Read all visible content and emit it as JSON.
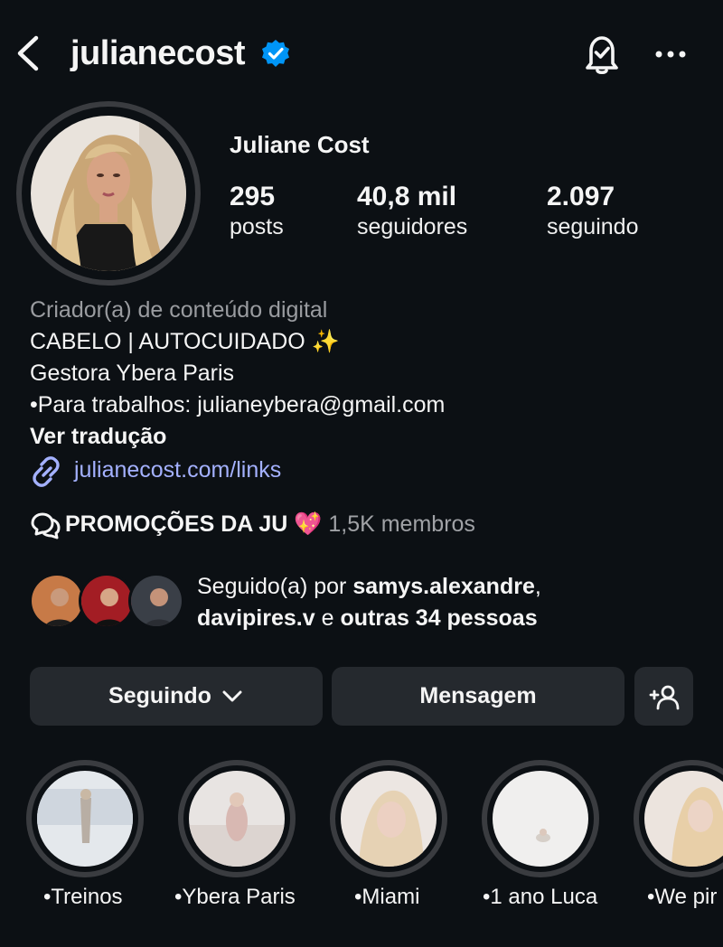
{
  "header": {
    "username": "julianecost",
    "icons": {
      "back": "chevron-left-icon",
      "verified": "verified-badge-icon",
      "notifications": "bell-check-icon",
      "more": "more-horizontal-icon"
    }
  },
  "profile": {
    "full_name": "Juliane Cost",
    "stats": [
      {
        "value": "295",
        "label": "posts"
      },
      {
        "value": "40,8 mil",
        "label": "seguidores"
      },
      {
        "value": "2.097",
        "label": "seguindo"
      }
    ]
  },
  "bio": {
    "category": "Criador(a) de conteúdo digital",
    "line1": "CABELO | AUTOCUIDADO ✨",
    "line2": "Gestora Ybera Paris",
    "line3": "•Para trabalhos: julianeybera@gmail.com",
    "translate": "Ver tradução",
    "link": "julianecost.com/links"
  },
  "channel": {
    "name": "PROMOÇÕES DA JU 💖",
    "members": "1,5K membros"
  },
  "followed_by": {
    "prefix": "Seguido(a) por ",
    "user1": "samys.alexandre",
    "sep": ",",
    "user2": "davipires.v",
    "conj": " e ",
    "others": "outras 34 pessoas"
  },
  "actions": {
    "following": "Seguindo",
    "message": "Mensagem"
  },
  "highlights": [
    {
      "label": "•Treinos"
    },
    {
      "label": "•Ybera Paris"
    },
    {
      "label": "•Miami"
    },
    {
      "label": "•1 ano Luca"
    },
    {
      "label": "•We pir"
    }
  ],
  "colors": {
    "background": "#0c1014",
    "button": "#25292e",
    "link": "#a4b1ff",
    "verified": "#0095f6"
  }
}
